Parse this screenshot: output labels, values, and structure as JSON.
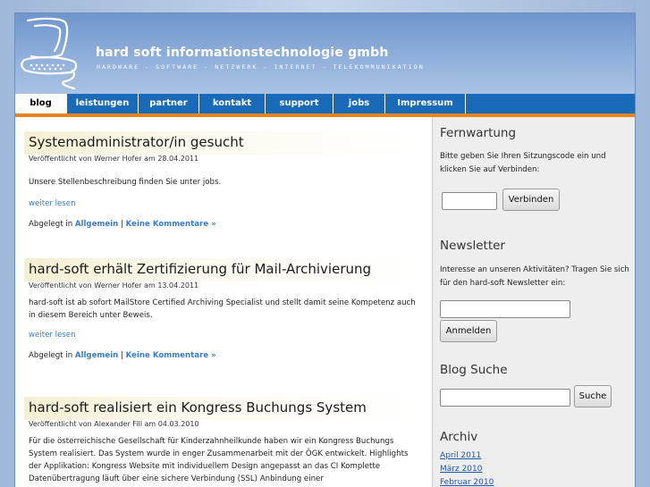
{
  "header": {
    "company_name": "hard soft informationstechnologie gmbh",
    "tagline": "HARDWARE - SOFTWARE - NETZWERK - INTERNET - TELEKOMMUNIKATION"
  },
  "nav": {
    "items": [
      "blog",
      "leistungen",
      "partner",
      "kontakt",
      "support",
      "jobs",
      "Impressum"
    ],
    "active": "blog"
  },
  "posts": [
    {
      "title": "Systemadministrator/in gesucht",
      "meta": "Veröffentlicht von Werner Hofer am 28.04.2011",
      "body": "Unsere Stellenbeschreibung finden Sie unter jobs.",
      "readmore": "weiter lesen",
      "filed_prefix": "Abgelegt in",
      "category": "Allgemein",
      "separator": "|",
      "comments": "Keine Kommentare »"
    },
    {
      "title": "hard-soft erhält Zertifizierung für Mail-Archivierung",
      "meta": "Veröffentlicht von Werner Hofer am 13.04.2011",
      "body": "hard-soft ist ab sofort MailStore Certified Archiving Specialist und stellt damit seine Kompetenz auch in diesem Bereich unter Beweis.",
      "readmore": "weiter lesen",
      "filed_prefix": "Abgelegt in",
      "category": "Allgemein",
      "separator": "|",
      "comments": "Keine Kommentare »"
    },
    {
      "title": "hard-soft realisiert ein Kongress Buchungs System",
      "meta": "Veröffentlicht von Alexander Fill am 04.03.2010",
      "body": "Für die österreichische Gesellschaft für Kinderzahnheilkunde haben wir ein Kongress Buchungs System realisiert. Das System wurde in enger Zusammenarbeit mit der ÖGK entwickelt. Highlights der Applikation: Kongress Website mit individuellem Design angepasst an das CI Komplette Datenübertragung läuft über eine sichere Verbindung (SSL) Anbindung einer"
    }
  ],
  "sidebar": {
    "fernwartung": {
      "heading": "Fernwartung",
      "text": "Bitte geben Sie Ihren Sitzungscode ein und klicken Sie auf Verbinden:",
      "button": "Verbinden",
      "input_value": ""
    },
    "newsletter": {
      "heading": "Newsletter",
      "text": "Interesse an unseren Aktivitäten? Tragen Sie sich für den hard-soft Newsletter ein:",
      "button": "Anmelden",
      "input_value": ""
    },
    "search": {
      "heading": "Blog Suche",
      "button": "Suche",
      "input_value": ""
    },
    "archive": {
      "heading": "Archiv",
      "links": [
        "April 2011",
        "März 2010",
        "Februar 2010"
      ]
    }
  },
  "colors": {
    "nav_bg": "#1a6aba",
    "nav_accent": "#e8831e",
    "link": "#3a7cc7",
    "header_top": "#6f95cc"
  }
}
